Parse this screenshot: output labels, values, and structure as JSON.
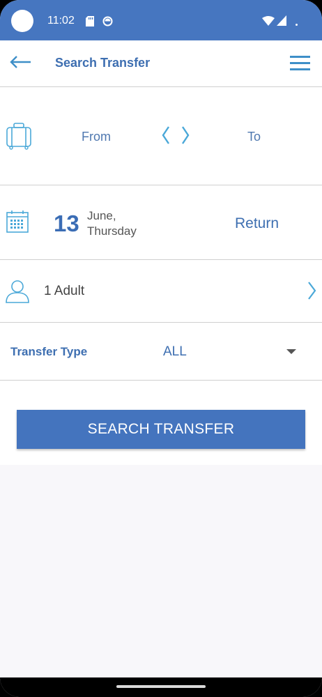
{
  "status_bar": {
    "time": "11:02"
  },
  "app_bar": {
    "title": "Search Transfer"
  },
  "route": {
    "from_label": "From",
    "to_label": "To"
  },
  "date": {
    "day": "13",
    "month": "June,",
    "weekday": "Thursday",
    "return_label": "Return"
  },
  "passengers": {
    "label": "1 Adult"
  },
  "transfer_type": {
    "label": "Transfer Type",
    "value": "ALL"
  },
  "search": {
    "button_label": "SEARCH TRANSFER"
  },
  "colors": {
    "primary": "#4474be",
    "accent": "#4aa8d8",
    "text_blue": "#3e6fb1"
  }
}
